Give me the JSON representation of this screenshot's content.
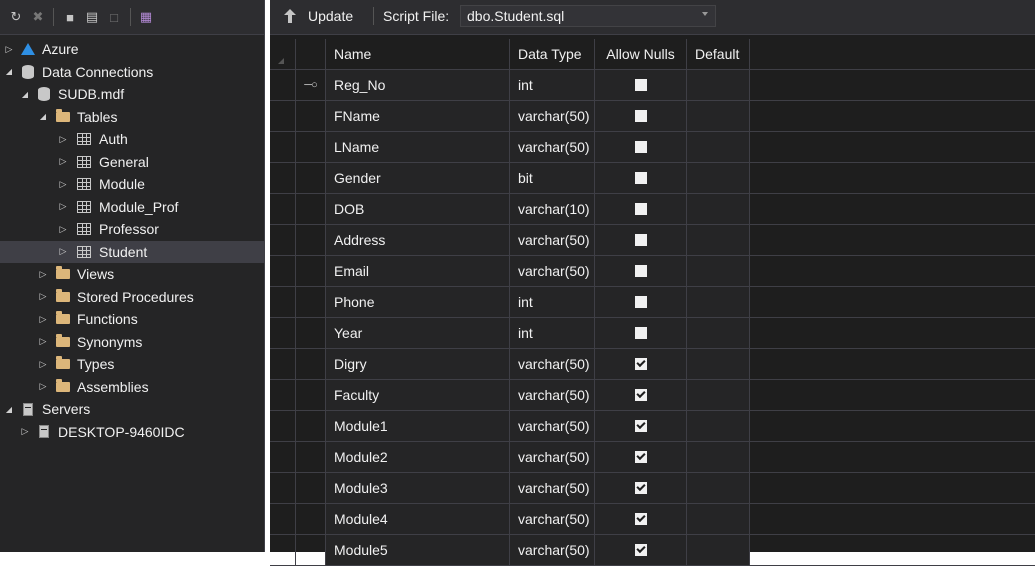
{
  "toolbar_icons": [
    "refresh-icon",
    "stop-icon",
    "add-database-icon",
    "add-server-icon",
    "add-table-icon",
    "diagram-icon"
  ],
  "tree": [
    {
      "level": 0,
      "arrow": "collapsed",
      "icon": "azure-icon",
      "label": "Azure"
    },
    {
      "level": 0,
      "arrow": "expanded",
      "icon": "data-connections-icon",
      "label": "Data Connections"
    },
    {
      "level": 1,
      "arrow": "expanded",
      "icon": "database-icon",
      "label": "SUDB.mdf"
    },
    {
      "level": 2,
      "arrow": "expanded",
      "icon": "folder-icon",
      "label": "Tables"
    },
    {
      "level": 3,
      "arrow": "collapsed",
      "icon": "table-icon",
      "label": "Auth"
    },
    {
      "level": 3,
      "arrow": "collapsed",
      "icon": "table-icon",
      "label": "General"
    },
    {
      "level": 3,
      "arrow": "collapsed",
      "icon": "table-icon",
      "label": "Module"
    },
    {
      "level": 3,
      "arrow": "collapsed",
      "icon": "table-icon",
      "label": "Module_Prof"
    },
    {
      "level": 3,
      "arrow": "collapsed",
      "icon": "table-icon",
      "label": "Professor"
    },
    {
      "level": 3,
      "arrow": "collapsed",
      "icon": "table-icon",
      "label": "Student",
      "selected": true
    },
    {
      "level": 2,
      "arrow": "collapsed",
      "icon": "folder-icon",
      "label": "Views"
    },
    {
      "level": 2,
      "arrow": "collapsed",
      "icon": "folder-icon",
      "label": "Stored Procedures"
    },
    {
      "level": 2,
      "arrow": "collapsed",
      "icon": "folder-icon",
      "label": "Functions"
    },
    {
      "level": 2,
      "arrow": "collapsed",
      "icon": "folder-icon",
      "label": "Synonyms"
    },
    {
      "level": 2,
      "arrow": "collapsed",
      "icon": "folder-icon",
      "label": "Types"
    },
    {
      "level": 2,
      "arrow": "collapsed",
      "icon": "folder-icon",
      "label": "Assemblies"
    },
    {
      "level": 0,
      "arrow": "expanded",
      "icon": "servers-icon",
      "label": "Servers"
    },
    {
      "level": 1,
      "arrow": "collapsed",
      "icon": "server-icon",
      "label": "DESKTOP-9460IDC"
    }
  ],
  "designer": {
    "update_label": "Update",
    "script_file_label": "Script File:",
    "script_file_value": "dbo.Student.sql",
    "columns": {
      "name": "Name",
      "data_type": "Data Type",
      "allow_nulls": "Allow Nulls",
      "default": "Default"
    },
    "rows": [
      {
        "name": "Reg_No",
        "type": "int",
        "nulls": false,
        "key": true
      },
      {
        "name": "FName",
        "type": "varchar(50)",
        "nulls": false
      },
      {
        "name": "LName",
        "type": "varchar(50)",
        "nulls": false
      },
      {
        "name": "Gender",
        "type": "bit",
        "nulls": false
      },
      {
        "name": "DOB",
        "type": "varchar(10)",
        "nulls": false
      },
      {
        "name": "Address",
        "type": "varchar(50)",
        "nulls": false
      },
      {
        "name": "Email",
        "type": "varchar(50)",
        "nulls": false
      },
      {
        "name": "Phone",
        "type": "int",
        "nulls": false
      },
      {
        "name": "Year",
        "type": "int",
        "nulls": false
      },
      {
        "name": "Digry",
        "type": "varchar(50)",
        "nulls": true
      },
      {
        "name": "Faculty",
        "type": "varchar(50)",
        "nulls": true
      },
      {
        "name": "Module1",
        "type": "varchar(50)",
        "nulls": true
      },
      {
        "name": "Module2",
        "type": "varchar(50)",
        "nulls": true
      },
      {
        "name": "Module3",
        "type": "varchar(50)",
        "nulls": true
      },
      {
        "name": "Module4",
        "type": "varchar(50)",
        "nulls": true
      },
      {
        "name": "Module5",
        "type": "varchar(50)",
        "nulls": true
      }
    ]
  }
}
